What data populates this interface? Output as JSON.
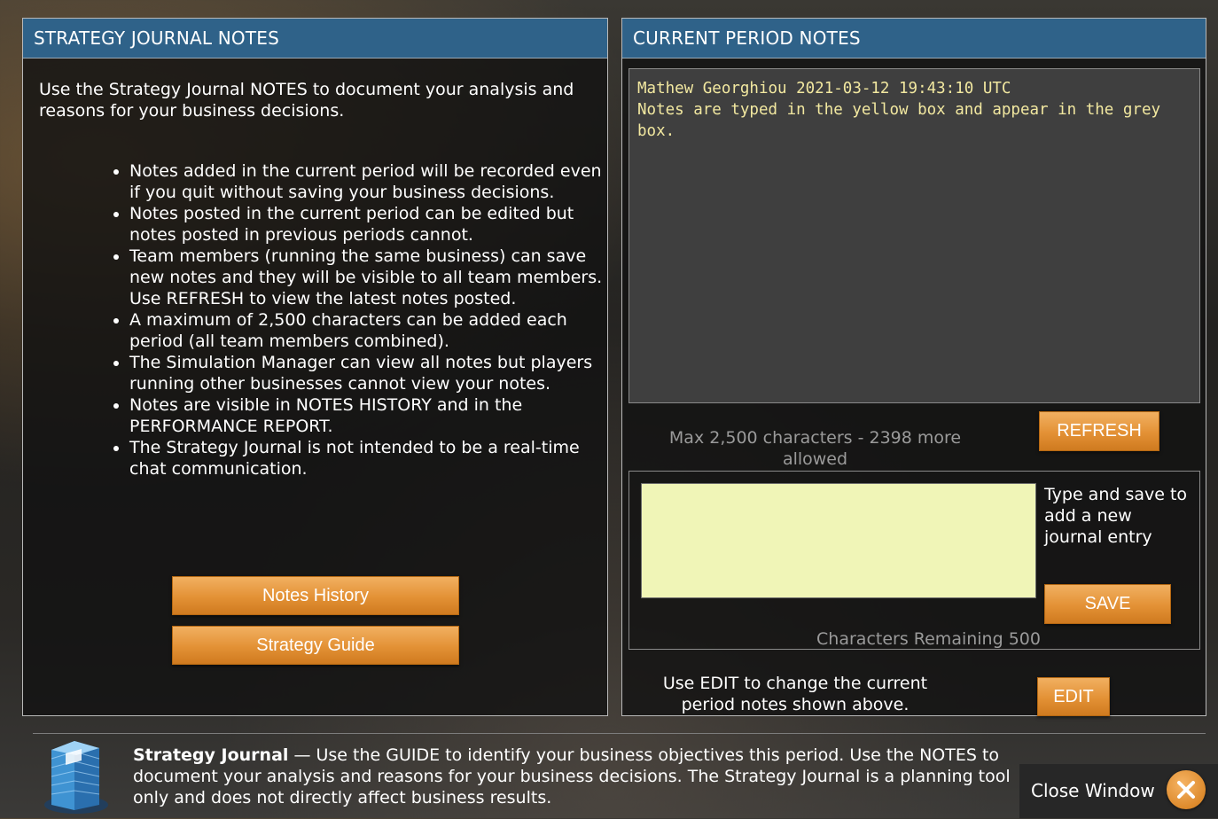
{
  "left_panel": {
    "title": "STRATEGY JOURNAL NOTES",
    "intro": "Use the Strategy Journal NOTES to document your analysis and reasons for your business decisions.",
    "rules": [
      "Notes added in the current period will be recorded even if you quit without saving your business decisions.",
      "Notes posted in the current period can be edited but notes posted in previous periods cannot.",
      "Team members (running the same business) can save new notes and they will be visible to all team members. Use REFRESH to view the latest notes posted.",
      "A maximum of 2,500 characters can be added each period (all team members combined).",
      "The Simulation Manager can view all notes but players running other businesses cannot view your notes.",
      "Notes are visible in NOTES HISTORY and in the PERFORMANCE REPORT.",
      "The Strategy Journal is not intended to be a real-time chat communication."
    ],
    "notes_history_label": "Notes History",
    "strategy_guide_label": "Strategy Guide"
  },
  "right_panel": {
    "title": "CURRENT PERIOD NOTES",
    "note_header": "Mathew Georghiou 2021-03-12 19:43:10 UTC",
    "note_body": "Notes are typed in the yellow box and appear in the grey box.",
    "max_info": "Max 2,500 characters - 2398 more allowed",
    "refresh_label": "REFRESH",
    "entry_value": "",
    "entry_help": "Type and save to add a new journal entry",
    "save_label": "SAVE",
    "chars_remaining": "Characters Remaining 500",
    "edit_info": "Use EDIT to change the current period notes shown above.",
    "edit_label": "EDIT"
  },
  "footer": {
    "title": "Strategy Journal",
    "text": " — Use the GUIDE to identify your business objectives this period. Use the NOTES to document your analysis and reasons for your business decisions. The Strategy Journal is a planning tool only and does not directly affect business results.",
    "close_label": "Close Window"
  },
  "colors": {
    "header_blue": "#2f6289",
    "button_orange": "#e39135",
    "note_yellow": "#f2e8a0",
    "entry_bg": "#f0f5b7"
  },
  "icons": {
    "building": "building-icon",
    "close": "close-icon"
  }
}
